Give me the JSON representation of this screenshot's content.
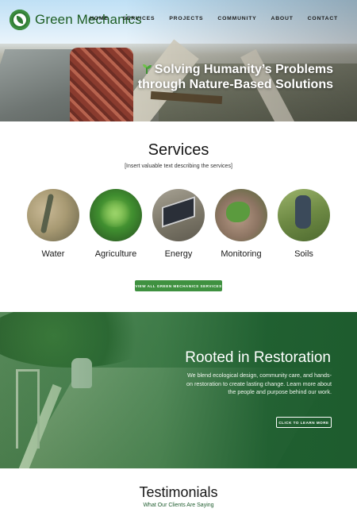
{
  "brand": {
    "name": "Green Mechanics",
    "accent": "#3f9140",
    "dark_green": "#1e5c2e"
  },
  "nav": {
    "items": [
      {
        "label": "HOME"
      },
      {
        "label": "SERVICES"
      },
      {
        "label": "PROJECTS"
      },
      {
        "label": "COMMUNITY"
      },
      {
        "label": "ABOUT"
      },
      {
        "label": "CONTACT"
      }
    ]
  },
  "hero": {
    "line1": "Solving Humanity’s Problems",
    "line2": "through Nature-Based Solutions",
    "icon": "sprout-icon"
  },
  "services": {
    "title": "Services",
    "subtitle": "[Insert valuable text describing the services]",
    "items": [
      {
        "label": "Water"
      },
      {
        "label": "Agriculture"
      },
      {
        "label": "Energy"
      },
      {
        "label": "Monitoring"
      },
      {
        "label": "Soils"
      }
    ],
    "button_label": "VIEW ALL GREEN MECHANICS SERVICES"
  },
  "restoration": {
    "title": "Rooted in Restoration",
    "body": "We blend ecological design, community care, and hands-on restoration to create lasting change. Learn more about the people and purpose behind our work.",
    "button_label": "CLICK TO LEARN MORE"
  },
  "testimonials": {
    "title": "Testimonials",
    "subtitle": "What Our Clients Are Saying"
  }
}
